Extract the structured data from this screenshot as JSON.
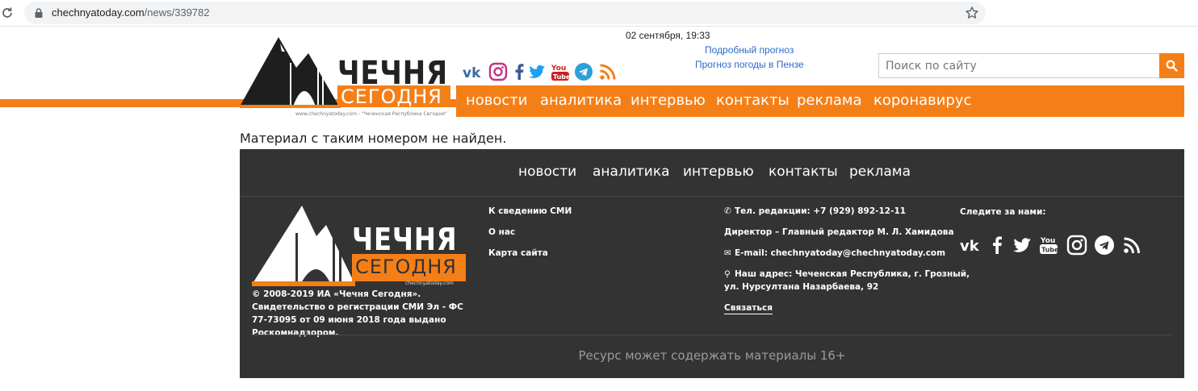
{
  "browser": {
    "url_host": "chechnyatoday.com",
    "url_path": "/news/339782"
  },
  "header": {
    "logo_title": "ЧЕЧНЯ",
    "logo_subtitle": "СЕГОДНЯ",
    "logo_tagline": "www.chechnyatoday.com - \"Чеченская Республика Сегодня\"",
    "datetime": "02 сентября, 19:33",
    "weather_detailed": "Подробный прогноз",
    "weather_city": "Прогноз погоды в Пензе",
    "search_placeholder": "Поиск по сайту",
    "social_icons": [
      "vk-icon",
      "instagram-icon",
      "facebook-icon",
      "twitter-icon",
      "youtube-icon",
      "telegram-icon",
      "rss-icon"
    ]
  },
  "nav": {
    "items": [
      "новости",
      "аналитика",
      "интервью",
      "контакты",
      "реклама",
      "коронавирус"
    ]
  },
  "main": {
    "message": "Материал с таким номером не найден."
  },
  "footer": {
    "nav": [
      "новости",
      "аналитика",
      "интервью",
      "контакты",
      "реклама"
    ],
    "logo_title": "ЧЕЧНЯ",
    "logo_subtitle": "СЕГОДНЯ",
    "logo_small": "chechnyatoday.com",
    "copyright": "© 2008-2019 ИА «Чечня Сегодня». Свидетельство о регистрации СМИ Эл - ФС 77-73095 от 09 июня 2018 года выдано Роскомнадзором.",
    "links": [
      "К сведению СМИ",
      "О нас",
      "Карта сайта"
    ],
    "phone": "Тел. редакции: +7 (929) 892-12-11",
    "director": "Директор – Главный редактор М. Л. Хамидова",
    "email": "E-mail: chechnyatoday@chechnyatoday.com",
    "address_line1": "Наш адрес: Чеченская Республика, г. Грозный,",
    "address_line2": "ул. Нурсултана Назарбаева, 92",
    "contact_link": "Связаться",
    "follow_label": "Следите за нами:",
    "social_icons": [
      "vk-icon",
      "facebook-icon",
      "twitter-icon",
      "youtube-icon",
      "instagram-icon",
      "telegram-icon",
      "rss-icon"
    ],
    "disclaimer": "Ресурс может содержать материалы 16+"
  },
  "colors": {
    "accent": "#f57f17",
    "footer_bg": "#333333",
    "link": "#2a6bc9"
  }
}
